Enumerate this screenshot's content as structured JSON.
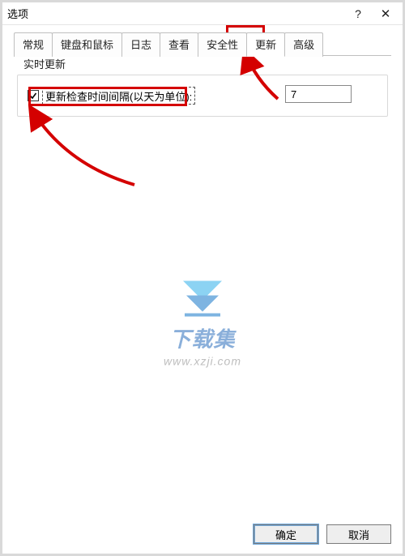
{
  "window": {
    "title": "选项"
  },
  "titlebar": {
    "help": "?",
    "close": "✕"
  },
  "tabs": {
    "general": "常规",
    "keyboard": "键盘和鼠标",
    "log": "日志",
    "view": "查看",
    "security": "安全性",
    "update": "更新",
    "advanced": "高级",
    "active_index": 5
  },
  "update_tab": {
    "group_title": "实时更新",
    "check_label": "更新检查时间间隔(以天为单位):",
    "checked": true,
    "interval_value": "7"
  },
  "buttons": {
    "ok": "确定",
    "cancel": "取消"
  },
  "watermark": {
    "brand": "下载集",
    "domain": "www.xzji.com"
  },
  "colors": {
    "annotation_red": "#d40000",
    "link_blue": "#2b6fbd"
  }
}
